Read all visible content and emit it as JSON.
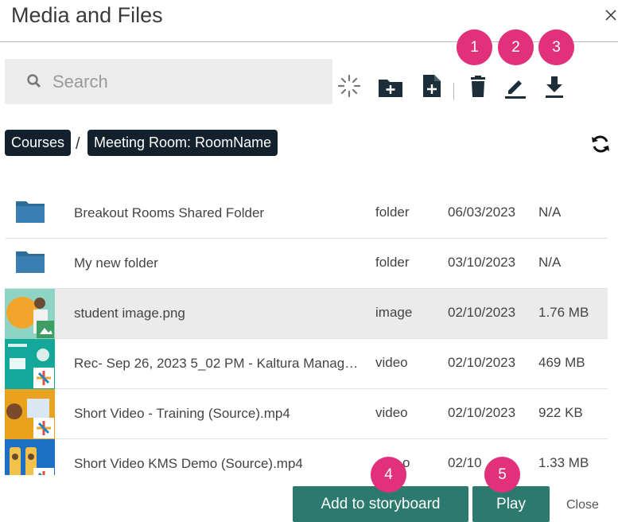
{
  "dialog": {
    "title": "Media and Files",
    "close_icon": "close-icon"
  },
  "search": {
    "placeholder": "Search"
  },
  "toolbar": {
    "icons": [
      "loading-spinner-icon",
      "new-folder-icon",
      "new-file-icon",
      "delete-icon",
      "edit-icon",
      "download-icon"
    ]
  },
  "badges": [
    "1",
    "2",
    "3",
    "4",
    "5"
  ],
  "breadcrumb": {
    "items": [
      "Courses",
      "Meeting Room: RoomName"
    ],
    "separator": "/"
  },
  "files": [
    {
      "name": "Breakout Rooms Shared Folder",
      "type": "folder",
      "date": "06/03/2023",
      "size": "N/A"
    },
    {
      "name": "My new folder",
      "type": "folder",
      "date": "03/10/2023",
      "size": "N/A"
    },
    {
      "name": "student image.png",
      "type": "image",
      "date": "02/10/2023",
      "size": "1.76 MB"
    },
    {
      "name": "Rec- Sep 26, 2023 5_02 PM - Kaltura Manag…",
      "type": "video",
      "date": "02/10/2023",
      "size": "469 MB"
    },
    {
      "name": "Short Video - Training (Source).mp4",
      "type": "video",
      "date": "02/10/2023",
      "size": "922 KB"
    },
    {
      "name": "Short Video KMS Demo (Source).mp4",
      "type": "o",
      "date": "02/10",
      "size": "1.33 MB"
    }
  ],
  "buttons": {
    "add_to_storyboard": "Add to storyboard",
    "play": "Play",
    "close": "Close"
  },
  "colors": {
    "accent": "#2c7a6e",
    "badge": "#e0317a",
    "crumb": "#12212b",
    "folder": "#2d6d9b"
  }
}
